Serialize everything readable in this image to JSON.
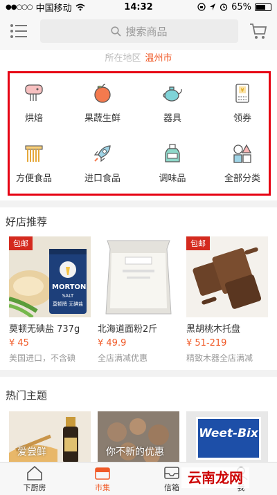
{
  "status_bar": {
    "carrier": "中国移动",
    "time": "14:32",
    "battery": "65%",
    "battery_level": 0.65
  },
  "header": {
    "search_placeholder": "搜索商品",
    "menu_icon": "menu-icon",
    "cart_icon": "cart-icon"
  },
  "region": {
    "label": "所在地区",
    "city": "温州市"
  },
  "categories": [
    {
      "label": "烘焙",
      "icon": "mixer-icon"
    },
    {
      "label": "果蔬生鲜",
      "icon": "fruit-icon"
    },
    {
      "label": "器具",
      "icon": "teapot-icon"
    },
    {
      "label": "领券",
      "icon": "coupon-icon"
    },
    {
      "label": "方便食品",
      "icon": "noodles-icon"
    },
    {
      "label": "进口食品",
      "icon": "rocket-icon"
    },
    {
      "label": "调味品",
      "icon": "bottle-icon"
    },
    {
      "label": "全部分类",
      "icon": "shapes-icon"
    }
  ],
  "shops": {
    "title": "好店推荐",
    "items": [
      {
        "badge": "包邮",
        "name": "莫顿无碘盐 737g",
        "price": "¥ 45",
        "note": "美国进口，不含碘",
        "product_text": "MORTON",
        "product_sub": "SALT",
        "product_cn": "莫顿牌 无碘盐"
      },
      {
        "badge": "",
        "name": "北海道面粉2斤",
        "price": "¥ 49.9",
        "note": "全店满减优惠"
      },
      {
        "badge": "包邮",
        "name": "黑胡桃木托盘",
        "price": "¥ 51-219",
        "note": "精致木器全店满减"
      }
    ]
  },
  "themes": {
    "title": "热门主题",
    "items": [
      {
        "caption": "爱尝鲜"
      },
      {
        "caption": "你不新的优惠"
      },
      {
        "caption": "Weet-Bix"
      }
    ]
  },
  "tabbar": {
    "items": [
      {
        "label": "下厨房",
        "icon": "home-icon"
      },
      {
        "label": "市集",
        "icon": "market-icon",
        "active": true
      },
      {
        "label": "信箱",
        "icon": "mailbox-icon"
      },
      {
        "label": "我",
        "icon": "profile-icon"
      }
    ]
  },
  "watermark": "云南龙网",
  "colors": {
    "accent": "#f05a28",
    "frame": "#e60012",
    "badge": "#d42a1e"
  }
}
